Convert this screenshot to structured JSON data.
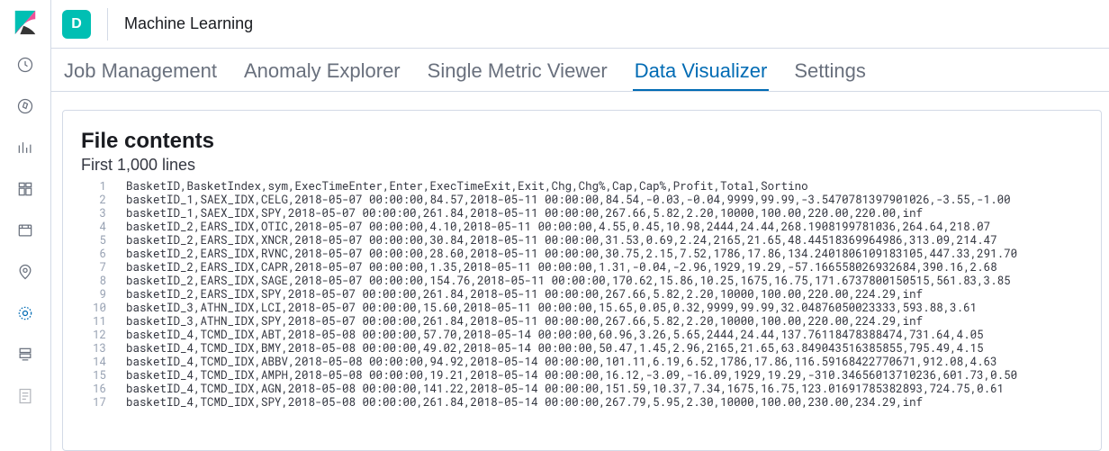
{
  "space_badge": "D",
  "app_title": "Machine Learning",
  "tabs": [
    {
      "label": "Job Management",
      "active": false
    },
    {
      "label": "Anomaly Explorer",
      "active": false
    },
    {
      "label": "Single Metric Viewer",
      "active": false
    },
    {
      "label": "Data Visualizer",
      "active": true
    },
    {
      "label": "Settings",
      "active": false
    }
  ],
  "panel": {
    "title": "File contents",
    "subtitle": "First 1,000 lines",
    "lines": [
      "BasketID,BasketIndex,sym,ExecTimeEnter,Enter,ExecTimeExit,Exit,Chg,Chg%,Cap,Cap%,Profit,Total,Sortino",
      "basketID_1,SAEX_IDX,CELG,2018-05-07 00:00:00,84.57,2018-05-11 00:00:00,84.54,-0.03,-0.04,9999,99.99,-3.5470781397901026,-3.55,-1.00",
      "basketID_1,SAEX_IDX,SPY,2018-05-07 00:00:00,261.84,2018-05-11 00:00:00,267.66,5.82,2.20,10000,100.00,220.00,220.00,inf",
      "basketID_2,EARS_IDX,OTIC,2018-05-07 00:00:00,4.10,2018-05-11 00:00:00,4.55,0.45,10.98,2444,24.44,268.1908199781036,264.64,218.07",
      "basketID_2,EARS_IDX,XNCR,2018-05-07 00:00:00,30.84,2018-05-11 00:00:00,31.53,0.69,2.24,2165,21.65,48.44518369964986,313.09,214.47",
      "basketID_2,EARS_IDX,RVNC,2018-05-07 00:00:00,28.60,2018-05-11 00:00:00,30.75,2.15,7.52,1786,17.86,134.2401806109183105,447.33,291.70",
      "basketID_2,EARS_IDX,CAPR,2018-05-07 00:00:00,1.35,2018-05-11 00:00:00,1.31,-0.04,-2.96,1929,19.29,-57.166558026932684,390.16,2.68",
      "basketID_2,EARS_IDX,SAGE,2018-05-07 00:00:00,154.76,2018-05-11 00:00:00,170.62,15.86,10.25,1675,16.75,171.6737800150515,561.83,3.85",
      "basketID_2,EARS_IDX,SPY,2018-05-07 00:00:00,261.84,2018-05-11 00:00:00,267.66,5.82,2.20,10000,100.00,220.00,224.29,inf",
      "basketID_3,ATHN_IDX,LCI,2018-05-07 00:00:00,15.60,2018-05-11 00:00:00,15.65,0.05,0.32,9999,99.99,32.04876050023333,593.88,3.61",
      "basketID_3,ATHN_IDX,SPY,2018-05-07 00:00:00,261.84,2018-05-11 00:00:00,267.66,5.82,2.20,10000,100.00,220.00,224.29,inf",
      "basketID_4,TCMD_IDX,ABT,2018-05-08 00:00:00,57.70,2018-05-14 00:00:00,60.96,3.26,5.65,2444,24.44,137.76118478388474,731.64,4.05",
      "basketID_4,TCMD_IDX,BMY,2018-05-08 00:00:00,49.02,2018-05-14 00:00:00,50.47,1.45,2.96,2165,21.65,63.849043516385855,795.49,4.15",
      "basketID_4,TCMD_IDX,ABBV,2018-05-08 00:00:00,94.92,2018-05-14 00:00:00,101.11,6.19,6.52,1786,17.86,116.59168422770671,912.08,4.63",
      "basketID_4,TCMD_IDX,AMPH,2018-05-08 00:00:00,19.21,2018-05-14 00:00:00,16.12,-3.09,-16.09,1929,19.29,-310.34656013710236,601.73,0.50",
      "basketID_4,TCMD_IDX,AGN,2018-05-08 00:00:00,141.22,2018-05-14 00:00:00,151.59,10.37,7.34,1675,16.75,123.01691785382893,724.75,0.61",
      "basketID_4,TCMD_IDX,SPY,2018-05-08 00:00:00,261.84,2018-05-14 00:00:00,267.79,5.95,2.30,10000,100.00,230.00,234.29,inf"
    ]
  },
  "rail_icons": [
    "clock-icon",
    "compass-icon",
    "visualize-icon",
    "dashboard-icon",
    "timelion-icon",
    "maps-icon",
    "ml-icon",
    "infra-icon",
    "logs-icon"
  ]
}
